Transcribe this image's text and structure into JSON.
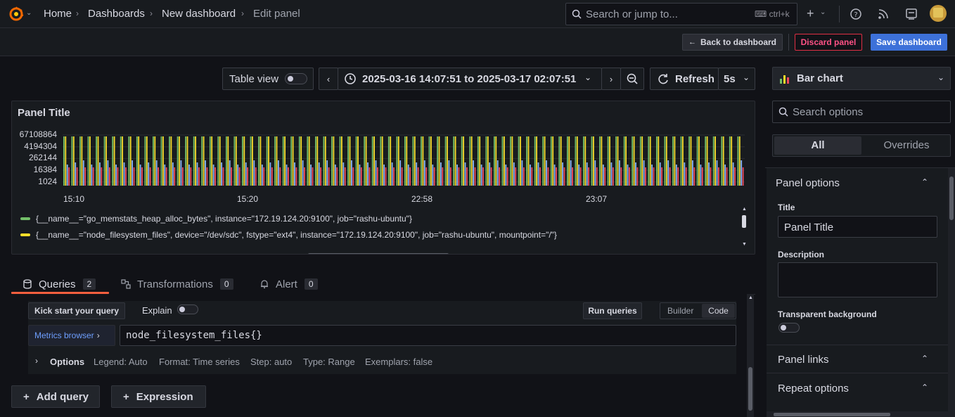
{
  "breadcrumbs": [
    "Home",
    "Dashboards",
    "New dashboard",
    "Edit panel"
  ],
  "search": {
    "placeholder": "Search or jump to...",
    "shortcut": "ctrl+k"
  },
  "actions": {
    "back": "Back to dashboard",
    "discard": "Discard panel",
    "save": "Save dashboard"
  },
  "toolbar": {
    "table_view": "Table view",
    "time_range": "2025-03-16 14:07:51 to 2025-03-17 02:07:51",
    "refresh": "Refresh",
    "interval": "5s"
  },
  "panel": {
    "title": "Panel Title",
    "y_ticks": [
      "67108864",
      "4194304",
      "262144",
      "16384",
      "1024"
    ],
    "x_ticks": [
      "15:10",
      "15:20",
      "22:58",
      "23:07"
    ],
    "legend": [
      {
        "label": "{__name__=\"go_memstats_heap_alloc_bytes\", instance=\"172.19.124.20:9100\", job=\"rashu-ubuntu\"}",
        "color": "#73bf69"
      },
      {
        "label": "{__name__=\"node_filesystem_files\", device=\"/dev/sdc\", fstype=\"ext4\", instance=\"172.19.124.20:9100\", job=\"rashu-ubuntu\", mountpoint=\"/\"}",
        "color": "#fade2a"
      }
    ]
  },
  "chart_data": {
    "type": "bar",
    "y_scale": "log2",
    "ylim": [
      1024,
      67108864
    ],
    "series_colors": [
      "#73bf69",
      "#fade2a",
      "#8ab8ff",
      "#f2495c"
    ]
  },
  "tabs": [
    {
      "label": "Queries",
      "count": "2"
    },
    {
      "label": "Transformations",
      "count": "0"
    },
    {
      "label": "Alert",
      "count": "0"
    }
  ],
  "query": {
    "kick_start": "Kick start your query",
    "explain": "Explain",
    "run": "Run queries",
    "builder": "Builder",
    "code": "Code",
    "metrics_browser": "Metrics browser",
    "expr": "node_filesystem_files{}",
    "options_label": "Options",
    "opts": [
      "Legend: Auto",
      "Format: Time series",
      "Step: auto",
      "Type: Range",
      "Exemplars: false"
    ],
    "add_query": "Add query",
    "expression": "Expression"
  },
  "viz": {
    "picker": "Bar chart",
    "search_placeholder": "Search options",
    "all": "All",
    "overrides": "Overrides"
  },
  "options": {
    "section": "Panel options",
    "title_label": "Title",
    "title_value": "Panel Title",
    "description_label": "Description",
    "transparent_label": "Transparent background",
    "links": "Panel links",
    "repeat": "Repeat options"
  }
}
